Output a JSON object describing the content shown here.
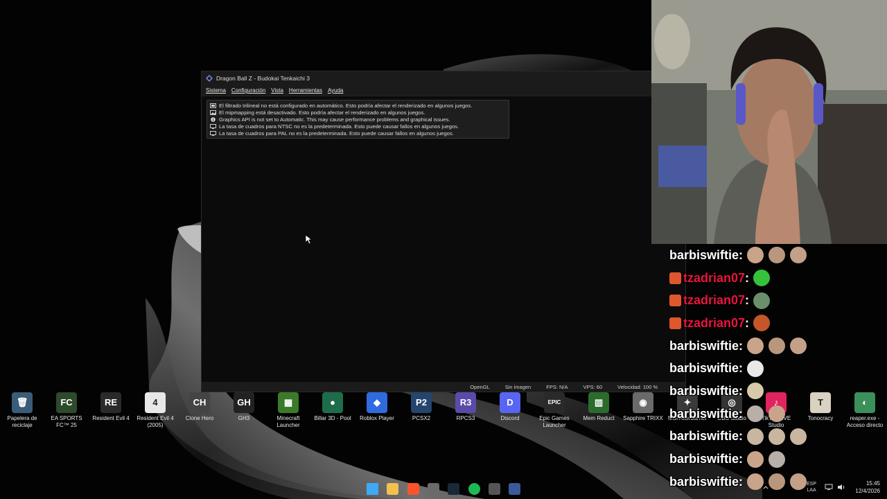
{
  "window": {
    "title": "Dragon Ball Z - Budokai Tenkaichi 3",
    "minimize_glyph": "—",
    "menu": [
      "Sistema",
      "Configuración",
      "Vista",
      "Herramientas",
      "Ayuda"
    ],
    "notices": [
      {
        "icon": "display-icon",
        "text": "El filtrado trilineal no está configurado en automático. Esto podría afectar el renderizado en algunos juegos."
      },
      {
        "icon": "image-icon",
        "text": "El mipmapping está desactivado. Esto podría afectar el renderizado en algunos juegos."
      },
      {
        "icon": "info-icon",
        "text": "Graphics API is not set to Automatic. This may cause performance problems and graphical issues."
      },
      {
        "icon": "monitor-icon",
        "text": "La tasa de cuadros para NTSC no es la predeterminada. Esto puede causar fallos en algunos juegos."
      },
      {
        "icon": "monitor-icon",
        "text": "La tasa de cuadros para PAL no es la predeterminada. Esto puede causar fallos en algunos juegos."
      }
    ],
    "status": {
      "renderer": "OpenGL",
      "image": "Sin imagen",
      "fps": "FPS: N/A",
      "vps": "VPS: 60",
      "speed": "Velocidad: 100 %"
    }
  },
  "desktop_icons": [
    {
      "label": "Papelera de reciclaje",
      "color": "#3a5c78",
      "glyph": "🗑"
    },
    {
      "label": "EA SPORTS FC™ 25",
      "color": "#2d4a2a",
      "glyph": "FC"
    },
    {
      "label": "Resident Evil 4",
      "color": "#2a2a2a",
      "glyph": "RE"
    },
    {
      "label": "Resident Evil 4 (2005)",
      "color": "#e8e8e8",
      "glyph": "4"
    },
    {
      "label": "Clone Hero",
      "color": "#444444",
      "glyph": "CH"
    },
    {
      "label": "GH3",
      "color": "#222222",
      "glyph": "GH"
    },
    {
      "label": "Minecraft Launcher",
      "color": "#3b7a2a",
      "glyph": "▦"
    },
    {
      "label": "Billar 3D - Pool",
      "color": "#1e6d4a",
      "glyph": "●"
    },
    {
      "label": "Roblox Player",
      "color": "#2f6be0",
      "glyph": "◆"
    },
    {
      "label": "PCSX2",
      "color": "#24456e",
      "glyph": "P2"
    },
    {
      "label": "RPCS3",
      "color": "#5b4aa8",
      "glyph": "R3"
    },
    {
      "label": "Discord",
      "color": "#5865f2",
      "glyph": "D"
    },
    {
      "label": "Epic Games Launcher",
      "color": "#2a2a2a",
      "glyph": "EPIC"
    },
    {
      "label": "Mem Reduct",
      "color": "#2b6b2b",
      "glyph": "▥"
    },
    {
      "label": "Sapphire TRIXX",
      "color": "#6a6a6a",
      "glyph": "◉"
    },
    {
      "label": "MSI Afterburner",
      "color": "#3a3a3a",
      "glyph": "✦"
    },
    {
      "label": "OBS Studio",
      "color": "#333333",
      "glyph": "◎"
    },
    {
      "label": "TikTok LIVE Studio",
      "color": "#e0245e",
      "glyph": "♪"
    },
    {
      "label": "Tonocracy",
      "color": "#d9d2c0",
      "glyph": "T"
    },
    {
      "label": "reaper.exe - Acceso directo",
      "color": "#3a8f5a",
      "glyph": "◐"
    }
  ],
  "chat": [
    {
      "user": "barbiswiftie",
      "badge": false,
      "red": false,
      "emotes": [
        "#c9a48a",
        "#b8977d",
        "#c4a088"
      ]
    },
    {
      "user": "tzadrian07",
      "badge": true,
      "red": true,
      "emotes": [
        "#33c23a"
      ]
    },
    {
      "user": "tzadrian07",
      "badge": true,
      "red": true,
      "emotes": [
        "#6b8f6b"
      ]
    },
    {
      "user": "tzadrian07",
      "badge": true,
      "red": true,
      "emotes": [
        "#c4562a"
      ]
    },
    {
      "user": "barbiswiftie",
      "badge": false,
      "red": false,
      "emotes": [
        "#c9a48a",
        "#b8977d",
        "#c4a088"
      ]
    },
    {
      "user": "barbiswiftie",
      "badge": false,
      "red": false,
      "emotes": [
        "#e8e8e8"
      ]
    },
    {
      "user": "barbiswiftie",
      "badge": false,
      "red": false,
      "emotes": [
        "#d8c9a8"
      ]
    },
    {
      "user": "barbiswiftie",
      "badge": false,
      "red": false,
      "emotes": [
        "#b8b0a8",
        "#c9a48a"
      ]
    },
    {
      "user": "barbiswiftie",
      "badge": false,
      "red": false,
      "emotes": [
        "#c9b6a0",
        "#c9b6a0",
        "#c9b6a0"
      ]
    },
    {
      "user": "barbiswiftie",
      "badge": false,
      "red": false,
      "emotes": [
        "#c9a48a",
        "#b8b0a8"
      ]
    },
    {
      "user": "barbiswiftie",
      "badge": false,
      "red": false,
      "emotes": [
        "#c9a48a",
        "#b8977d",
        "#c4a088"
      ]
    }
  ],
  "taskbar": {
    "apps": [
      {
        "name": "start-icon",
        "color": "#3fa9f5"
      },
      {
        "name": "file-explorer-icon",
        "color": "#f2c14e"
      },
      {
        "name": "brave-icon",
        "color": "#fb542b"
      },
      {
        "name": "store-icon",
        "color": "#6a6a6a"
      },
      {
        "name": "steam-icon",
        "color": "#1b2838"
      },
      {
        "name": "spotify-icon",
        "color": "#1db954"
      },
      {
        "name": "obs-icon",
        "color": "#555555"
      },
      {
        "name": "pcsx2-icon",
        "color": "#3a5a9a"
      }
    ],
    "lang_top": "ESP",
    "lang_bottom": "LAA",
    "time": "15:45",
    "date": "12/4/2026"
  }
}
